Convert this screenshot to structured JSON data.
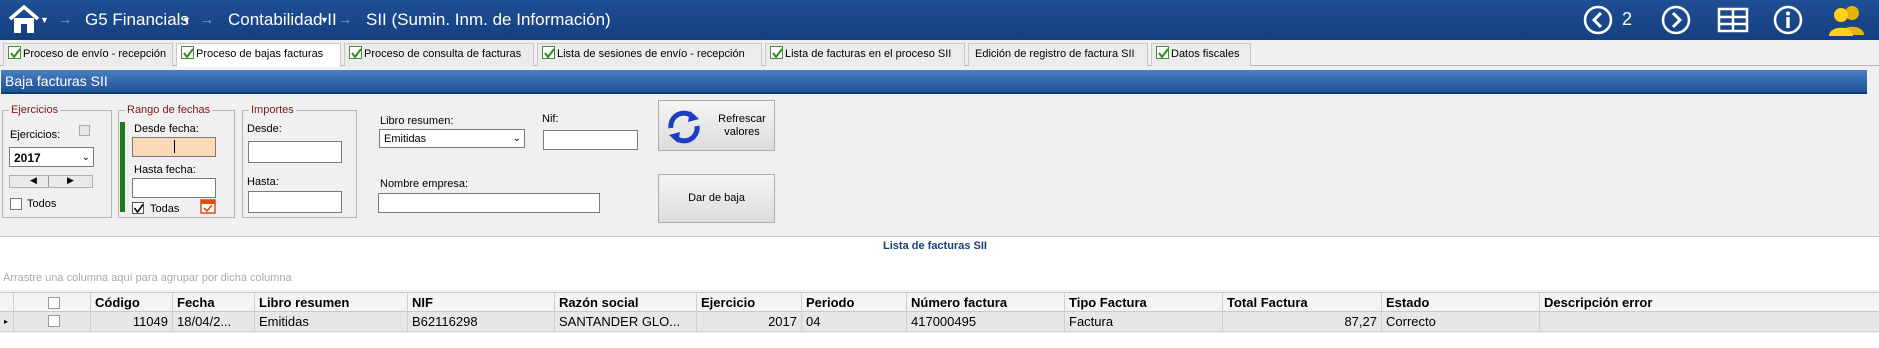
{
  "topbar": {
    "app_menu": "G5 Financials",
    "module_menu": "Contabilidad II",
    "page_title": "SII (Sumin. Inm. de Información)",
    "page_number": "2",
    "colors": {
      "bar": "#1c4a8f",
      "accent_user": "#f0c400"
    }
  },
  "tabs": [
    {
      "label": "Proceso de envío - recepción",
      "checked": true,
      "active": false
    },
    {
      "label": "Proceso de bajas facturas",
      "checked": true,
      "active": true
    },
    {
      "label": "Proceso de consulta de facturas",
      "checked": true,
      "active": false
    },
    {
      "label": "Lista de sesiones de envío - recepción",
      "checked": true,
      "active": false
    },
    {
      "label": "Lista de facturas en el proceso SII",
      "checked": true,
      "active": false
    },
    {
      "label": "Edición de registro de factura SII",
      "checked": false,
      "active": false
    },
    {
      "label": "Datos fiscales",
      "checked": true,
      "active": false
    }
  ],
  "section_title": "Baja facturas SII",
  "ejercicios": {
    "legend": "Ejercicios",
    "label": "Ejercicios:",
    "selected": "2017",
    "todos_label": "Todos"
  },
  "rango": {
    "legend": "Rango de fechas",
    "desde_label": "Desde fecha:",
    "hasta_label": "Hasta fecha:",
    "desde_value": "",
    "hasta_value": "",
    "todas_label": "Todas"
  },
  "importes": {
    "legend": "Importes",
    "desde_label": "Desde:",
    "hasta_label": "Hasta:",
    "desde_value": "",
    "hasta_value": ""
  },
  "filters": {
    "libro_label": "Libro resumen:",
    "libro_selected": "Emitidas",
    "nif_label": "Nif:",
    "nif_value": "",
    "empresa_label": "Nombre empresa:",
    "empresa_value": ""
  },
  "buttons": {
    "refrescar": "Refrescar valores",
    "refrescar_l1": "Refrescar",
    "refrescar_l2": "valores",
    "baja": "Dar de baja"
  },
  "grid": {
    "title": "Lista de facturas SII",
    "group_hint": "Arrastre una columna aquí para agrupar por dicha columna",
    "columns": [
      "Código",
      "Fecha",
      "Libro resumen",
      "NIF",
      "Razón social",
      "Ejercicio",
      "Periodo",
      "Número factura",
      "Tipo Factura",
      "Total Factura",
      "Estado",
      "Descripción error"
    ],
    "rows": [
      {
        "codigo": "11049",
        "fecha": "18/04/2...",
        "libro": "Emitidas",
        "nif": "B62116298",
        "razon": "SANTANDER GLO...",
        "ejercicio": "2017",
        "periodo": "04",
        "numero": "417000495",
        "tipo": "Factura",
        "total": "87,27",
        "estado": "Correcto",
        "error": ""
      }
    ]
  }
}
